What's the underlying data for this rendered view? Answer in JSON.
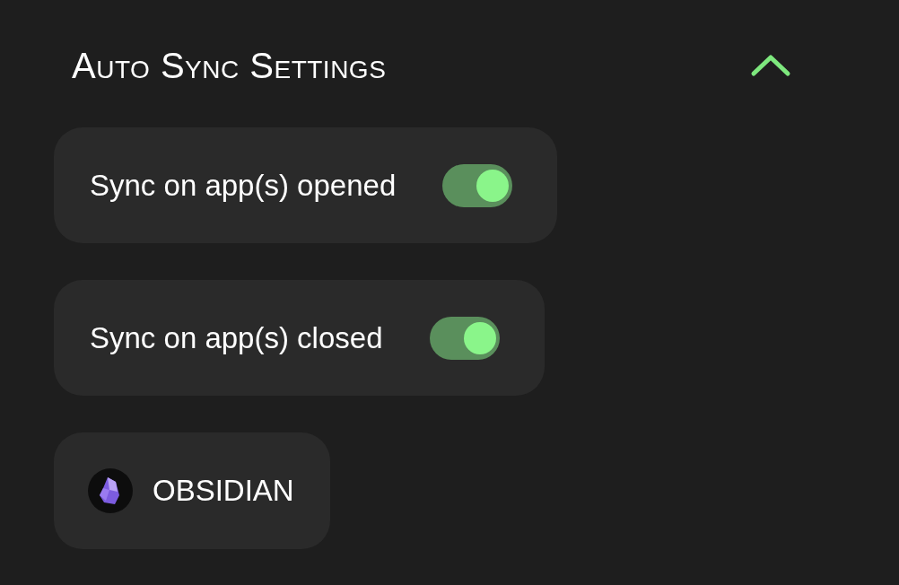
{
  "section": {
    "title": "Auto Sync Settings",
    "expanded": true
  },
  "settings": [
    {
      "label": "Sync on app(s) opened",
      "on": true
    },
    {
      "label": "Sync on app(s) closed",
      "on": true
    }
  ],
  "apps": [
    {
      "label": "OBSIDIAN"
    }
  ]
}
